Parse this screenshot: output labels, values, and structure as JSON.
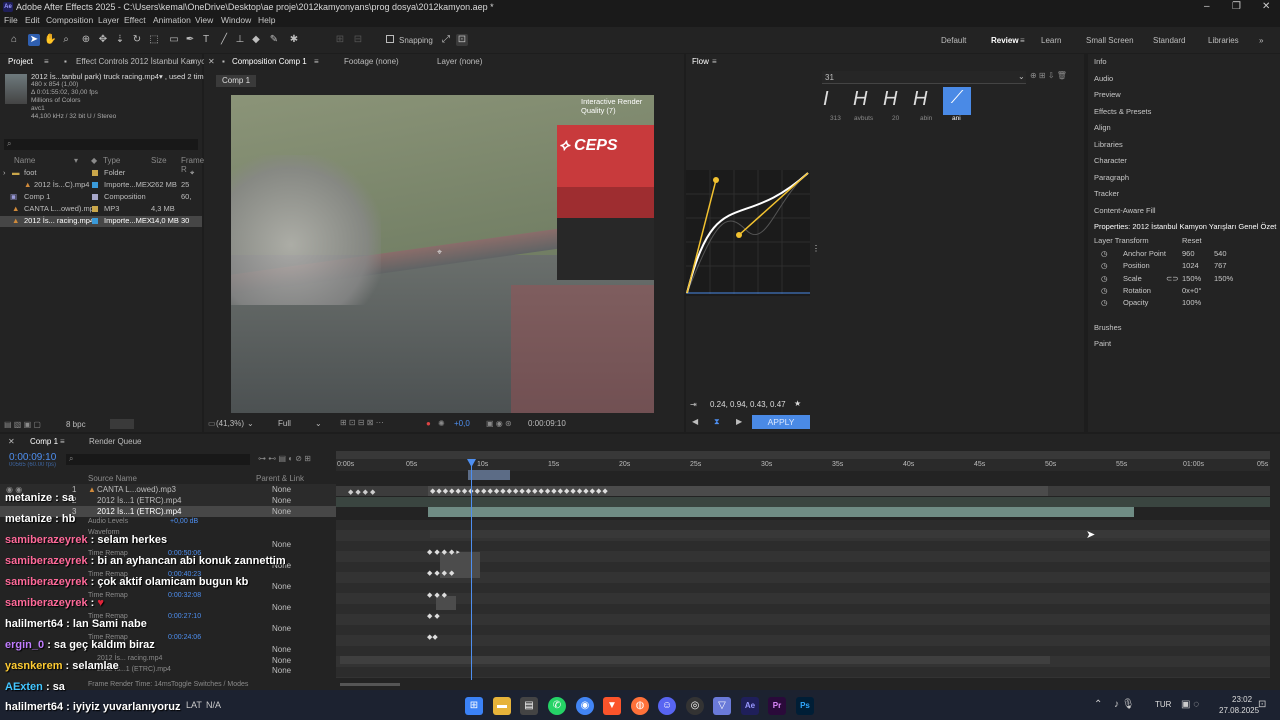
{
  "titlebar": {
    "title": "Adobe After Effects 2025 - C:\\Users\\kemal\\OneDrive\\Desktop\\ae proje\\2012kamyonyans\\prog dosya\\2012kamyon.aep *",
    "app_icon": "Ae"
  },
  "menu": [
    "File",
    "Edit",
    "Composition",
    "Layer",
    "Effect",
    "Animation",
    "View",
    "Window",
    "Help"
  ],
  "toolbar": {
    "snapping": "Snapping"
  },
  "workspaces": [
    "Default",
    "Review",
    "Learn",
    "Small Screen",
    "Standard",
    "Libraries"
  ],
  "project": {
    "tab_project": "Project",
    "tab_effect": "Effect Controls 2012 İstanbul Kamyon",
    "preview_name": "2012 İs...tanbul park) truck racing.mp4▾ , used 2 times",
    "preview_info": [
      "480 x 854 (1,00)",
      "Δ 0:01:55:02, 30,00 fps",
      "Millions of Colors",
      "avc1",
      "44,100 kHz / 32 bit U / Stereo"
    ],
    "search_placeholder": "",
    "columns": [
      "Name",
      "Type",
      "Size",
      "Frame R"
    ],
    "items": [
      {
        "name": "foot",
        "type": "Folder",
        "size": "",
        "fr": ""
      },
      {
        "name": "2012 İs...C).mp4",
        "type": "Importe...MEX",
        "size": "262 MB",
        "fr": "25"
      },
      {
        "name": "Comp 1",
        "type": "Composition",
        "size": "",
        "fr": "60,"
      },
      {
        "name": "CANTA L...owed).mp3",
        "type": "MP3",
        "size": "4,3 MB",
        "fr": ""
      },
      {
        "name": "2012 İs... racing.mp4",
        "type": "Importe...MEX",
        "size": "14,0 MB",
        "fr": "30"
      }
    ],
    "bpc": "8 bpc"
  },
  "viewer": {
    "tab_comp": "Composition Comp 1",
    "tab_footage": "Footage (none)",
    "tab_layer": "Layer (none)",
    "comp_chip": "Comp 1",
    "quality": "Interactive Render Quality (7)",
    "zoom": "(41,3%)",
    "resolution": "Full",
    "exposure": "+0,0",
    "timecode": "0:00:09:10"
  },
  "flow": {
    "tab": "Flow",
    "preset_value": "31",
    "presets": [
      {
        "label": "313"
      },
      {
        "label": "avbuts"
      },
      {
        "label": "20"
      },
      {
        "label": "abin"
      },
      {
        "label": "ani"
      }
    ],
    "values": "0.24, 0.94, 0.43, 0.47",
    "apply": "APPLY"
  },
  "rightpanel": {
    "items": [
      "Info",
      "Audio",
      "Preview",
      "Effects & Presets",
      "Align",
      "Libraries",
      "Character",
      "Paragraph",
      "Tracker",
      "Content-Aware Fill"
    ],
    "properties_title": "Properties: 2012 İstanbul Kamyon Yarışları Genel Özet",
    "layer_transform": "Layer Transform",
    "reset": "Reset",
    "props": [
      {
        "name": "Anchor Point",
        "v1": "960",
        "v2": "540"
      },
      {
        "name": "Position",
        "v1": "1024",
        "v2": "767"
      },
      {
        "name": "Scale",
        "v1": "150%",
        "v2": "150%"
      },
      {
        "name": "Rotation",
        "v1": "0x+0°",
        "v2": ""
      },
      {
        "name": "Opacity",
        "v1": "100%",
        "v2": ""
      }
    ],
    "bottom": [
      "Brushes",
      "Paint"
    ]
  },
  "timeline": {
    "tab_comp": "Comp 1",
    "tab_render": "Render Queue",
    "timecode": "0:00:09:10",
    "timecode_sub": "00565 (60.00 fps)",
    "source_name": "Source Name",
    "parent_link": "Parent & Link",
    "ruler": [
      "0:00s",
      "05s",
      "10s",
      "15s",
      "20s",
      "25s",
      "30s",
      "35s",
      "40s",
      "45s",
      "50s",
      "55s",
      "01:00s",
      "05s"
    ],
    "layers": [
      {
        "num": "1",
        "name": "CANTA L...owed).mp3",
        "parent": "None"
      },
      {
        "num": "2",
        "name": "2012 İs...1 (ETRC).mp4",
        "parent": "None"
      },
      {
        "num": "3",
        "name": "2012 İs...1 (ETRC).mp4",
        "parent": "None"
      }
    ],
    "sub_labels": [
      "Audio Levels",
      "Waveform",
      "Time Remap",
      "Time Remap",
      "Time Remap",
      "Time Remap",
      "Time Remap"
    ],
    "sub_values": [
      "+0,00 dB",
      "0:00:50:06",
      "0:00:40:23",
      "0:00:32:08",
      "0:00:27:10",
      "0:00:24:06"
    ],
    "lower_layers": [
      "2012 İs...1 (ETRC).mp4",
      "2012 İs... racing.mp4",
      "2012 İs...1 (ETRC).mp4"
    ],
    "render_time": "Frame Render Time: 14ms",
    "toggle": "Toggle Switches / Modes"
  },
  "chat": [
    {
      "user": "metanize",
      "msg": "sa",
      "color": "#ffffff"
    },
    {
      "user": "metanize",
      "msg": "hb",
      "color": "#ffffff"
    },
    {
      "user": "samiberazeyrek",
      "msg": "selam herkes",
      "color": "#ff6a9a"
    },
    {
      "user": "samiberazeyrek",
      "msg": "bi an ayhancan abi konuk zannettim",
      "color": "#ff6a9a"
    },
    {
      "user": "samiberazeyrek",
      "msg": "çok aktif olamicam bugun kb",
      "color": "#ff6a9a"
    },
    {
      "user": "samiberazeyrek",
      "msg": "",
      "color": "#ff6a9a"
    },
    {
      "user": "halilmert64",
      "msg": "lan Sami nabe",
      "color": "#ffffff"
    },
    {
      "user": "ergin_0",
      "msg": "sa geç kaldım biraz",
      "color": "#c07dff"
    },
    {
      "user": "yasnkerem",
      "msg": "selamlae",
      "color": "#ffcc33"
    },
    {
      "user": "AExten",
      "msg": "sa",
      "color": "#44c7ff"
    },
    {
      "user": "halilmert64",
      "msg": "iyiyiz yuvarlanıyoruz",
      "color": "#ffffff"
    }
  ],
  "taskbar": {
    "ticker": "LAT",
    "ticker_val": "N/A",
    "lang": "TUR",
    "time": "23:02",
    "date": "27.08.2025"
  }
}
